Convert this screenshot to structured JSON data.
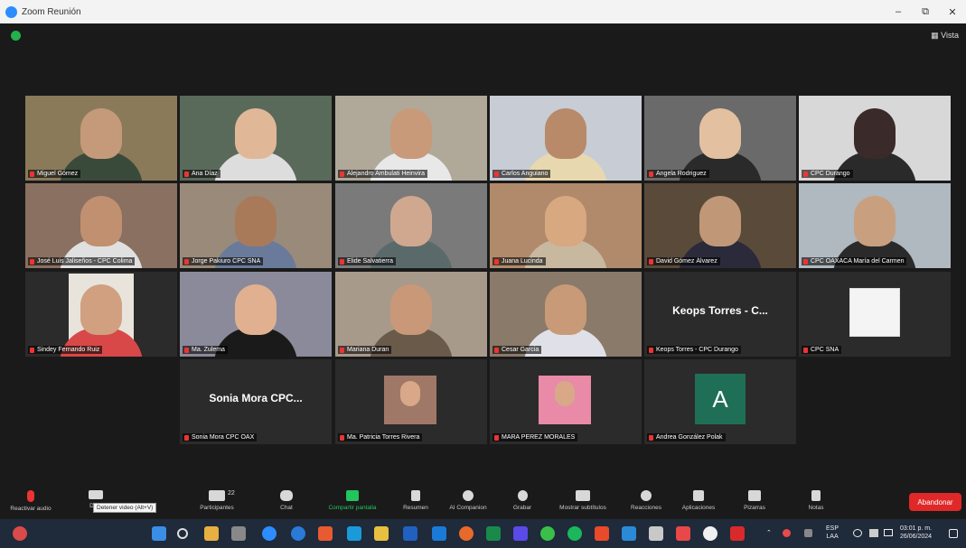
{
  "window": {
    "title": "Zoom Reunión",
    "min": "–",
    "max": "⧉",
    "close": "✕"
  },
  "meeting": {
    "view_label": "▦ Vista"
  },
  "tiles": [
    {
      "name": "Miguel Gómez",
      "bg": "#8a7a5a",
      "skin": "#c49a7a",
      "shirt": "#3a4a3a"
    },
    {
      "name": "Ana Díaz",
      "bg": "#5a6a5a",
      "skin": "#e0b898",
      "shirt": "#dddddd"
    },
    {
      "name": "Alejandro Ambulati Heinvira",
      "bg": "#b0a898",
      "skin": "#c89a7a",
      "shirt": "#e8e8e8"
    },
    {
      "name": "Carlos Anguiano",
      "bg": "#c8ccd4",
      "skin": "#b88a6a",
      "shirt": "#e8d8b0"
    },
    {
      "name": "Angela Rodriguez",
      "bg": "#6a6a6a",
      "skin": "#e2c0a0",
      "shirt": "#2a2a2a"
    },
    {
      "name": "CPC Durango",
      "bg": "#d8d8d8",
      "skin": "#3a2a2a",
      "shirt": "#2a2a2a"
    },
    {
      "name": "José Luis Jaliseños - CPC Colima",
      "bg": "#8a7060",
      "skin": "#c09070",
      "shirt": "#e0e0e0"
    },
    {
      "name": "Jorge Pakiuro CPC SNA",
      "bg": "#9a8a7a",
      "skin": "#a87a5a",
      "shirt": "#6a7a9a"
    },
    {
      "name": "Elide Salvatierra",
      "bg": "#7a7a7a",
      "skin": "#d0a890",
      "shirt": "#5a6a6a"
    },
    {
      "name": "Juana Lucinda",
      "bg": "#b08a6a",
      "skin": "#d8a880",
      "shirt": "#c8b8a0"
    },
    {
      "name": "David Gómez Álvarez",
      "bg": "#5a4a3a",
      "skin": "#c09878",
      "shirt": "#2a2a3a"
    },
    {
      "name": "CPC OAXACA María del Carmen",
      "bg": "#b0b8c0",
      "skin": "#c8a080",
      "shirt": "#2a2a2a"
    },
    {
      "name": "Sindey Fernando Ruiz",
      "bg": "#2b2b2b",
      "skin": "#d0a080",
      "shirt": "#d84848"
    },
    {
      "name": "Ma. Zulema",
      "bg": "#8a8a9a",
      "skin": "#e0b090",
      "shirt": "#1a1a1a"
    },
    {
      "name": "Mariana Duran",
      "bg": "#a89a8a",
      "skin": "#c89878",
      "shirt": "#6a5a4a"
    },
    {
      "name": "Cesar Garcia",
      "bg": "#8a7a6a",
      "skin": "#c89a78",
      "shirt": "#e0e0e8"
    },
    {
      "name": "Keops Torres - CPC Durango",
      "big": "Keops Torres - C..."
    },
    {
      "name": "CPC SNA"
    },
    {
      "name": "Sonia Mora CPC OAX",
      "big": "Sonia Mora CPC..."
    },
    {
      "name": "Ma. Patricia Torres Rivera"
    },
    {
      "name": "MARA PEREZ MORALES"
    },
    {
      "name": "Andrea González Polak",
      "avatar": "A"
    }
  ],
  "toolbar": {
    "audio": "Reactivar audio",
    "video": "Dete",
    "participants": "Participantes",
    "participants_count": "22",
    "chat": "Chat",
    "share": "Compartir pantalla",
    "summary": "Resumen",
    "companion": "AI Companion",
    "record": "Grabar",
    "captions": "Mostrar subtítulos",
    "reactions": "Reacciones",
    "apps": "Aplicaciones",
    "whiteboards": "Pizarras",
    "notes": "Notas",
    "leave": "Abandonar",
    "tooltip": "Detener video (Alt+V)"
  },
  "tray": {
    "lang1": "ESP",
    "lang2": "LAA",
    "time": "03:01 p. m.",
    "date": "26/06/2024"
  }
}
